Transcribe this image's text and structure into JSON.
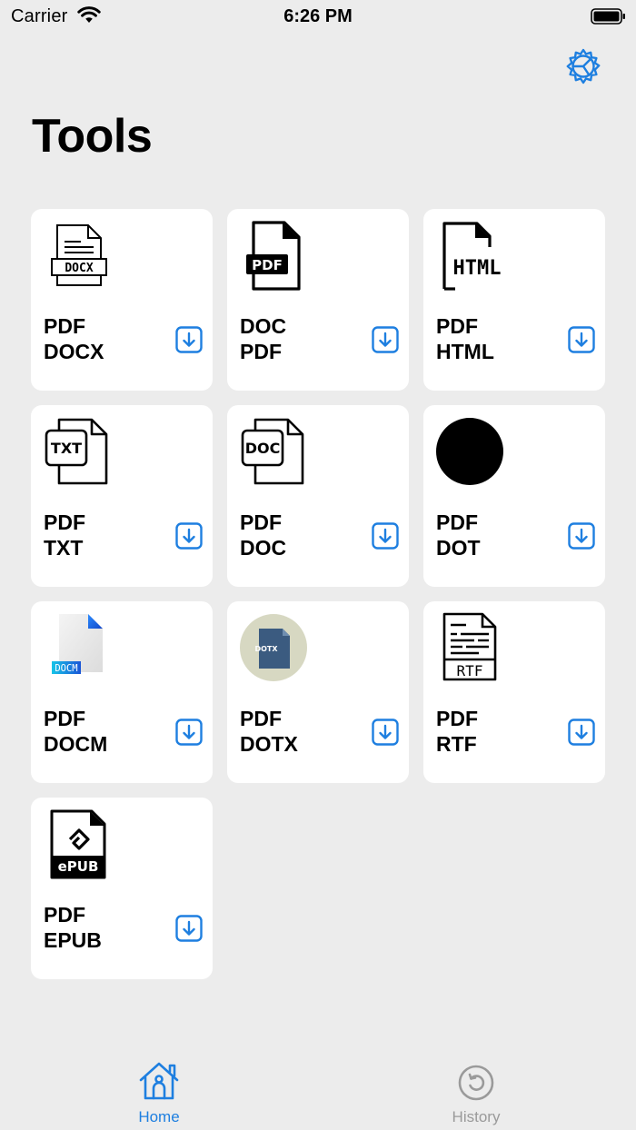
{
  "status_bar": {
    "carrier": "Carrier",
    "time": "6:26 PM"
  },
  "header": {
    "title": "Tools",
    "settings_icon": "gear-icon"
  },
  "tools": [
    {
      "line1": "PDF",
      "line2": "DOCX",
      "icon": "docx-file-icon"
    },
    {
      "line1": "DOC",
      "line2": "PDF",
      "icon": "pdf-file-icon"
    },
    {
      "line1": "PDF",
      "line2": "HTML",
      "icon": "html-file-icon"
    },
    {
      "line1": "PDF",
      "line2": "TXT",
      "icon": "txt-file-icon"
    },
    {
      "line1": "PDF",
      "line2": "DOC",
      "icon": "doc-file-icon"
    },
    {
      "line1": "PDF",
      "line2": "DOT",
      "icon": "dot-circle-icon"
    },
    {
      "line1": "PDF",
      "line2": "DOCM",
      "icon": "docm-file-icon"
    },
    {
      "line1": "PDF",
      "line2": "DOTX",
      "icon": "dotx-file-icon"
    },
    {
      "line1": "PDF",
      "line2": "RTF",
      "icon": "rtf-file-icon"
    },
    {
      "line1": "PDF",
      "line2": "EPUB",
      "icon": "epub-file-icon"
    }
  ],
  "icon_text": {
    "docx": "DOCX",
    "pdf": "PDF",
    "html": "HTML",
    "txt": "TXT",
    "doc": "DOC",
    "docm": "DOCM",
    "dotx": "DOTX",
    "rtf": "RTF",
    "epub": "ePUB"
  },
  "tab_bar": {
    "home": "Home",
    "history": "History"
  },
  "colors": {
    "accent": "#1e7fe0",
    "inactive": "#9a9a9a",
    "background": "#ececec",
    "card": "#ffffff"
  }
}
